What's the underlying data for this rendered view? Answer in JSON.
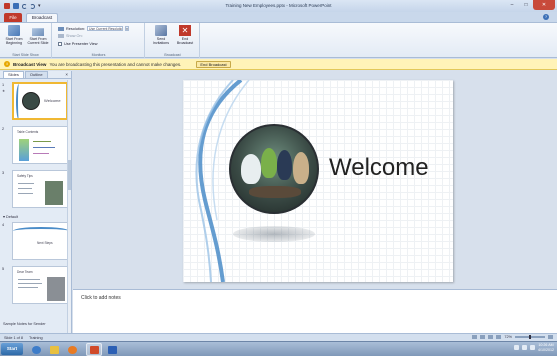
{
  "window": {
    "title": "Training New Employees.pptx - Microsoft PowerPoint",
    "minimize": "–",
    "maximize": "□",
    "close": "✕"
  },
  "qat": {
    "more": "▾"
  },
  "tabs": {
    "file": "File",
    "broadcast": "Broadcast",
    "help": "?"
  },
  "ribbon": {
    "start_broadcast": {
      "label": "Start From Beginning"
    },
    "start_current": {
      "label": "Start From Current Slide"
    },
    "start_group_label": "Start Slide Show",
    "monitor": {
      "resolution_label": "Resolution:",
      "resolution_value": "Use Current Resolution",
      "show_on_label": "Show On:",
      "presenter_view_label": "Use Presenter View",
      "group_label": "Monitors"
    },
    "send_invitations": {
      "label": "Send Invitations"
    },
    "end_broadcast": {
      "label": "End Broadcast",
      "icon_glyph": "✕"
    },
    "broadcast_group_label": "Broadcast"
  },
  "infobar": {
    "title": "Broadcast View",
    "message": "You are broadcasting this presentation and cannot make changes.",
    "button": "End Broadcast"
  },
  "left_panel": {
    "tab_slides": "Slides",
    "tab_outline": "Outline",
    "close_glyph": "×",
    "slides": [
      {
        "num": "1",
        "title": "Welcome"
      },
      {
        "num": "2",
        "title": "Table Contents"
      },
      {
        "num": "3",
        "title": "Safety Tips"
      },
      {
        "num": "4",
        "title": "Next Steps"
      },
      {
        "num": "5",
        "title": "Dear Team"
      }
    ],
    "section_label": "Default",
    "footer_label": "Sample Notes for Sender"
  },
  "slide": {
    "title": "Welcome"
  },
  "notes": {
    "placeholder": "Click to add notes"
  },
  "status": {
    "slide_info": "Slide 1 of 8",
    "theme": "Training",
    "zoom": "72%"
  },
  "taskbar": {
    "start": "Start",
    "apps": [
      {
        "icon": "ie-icon",
        "color": "#3d7cc9"
      },
      {
        "icon": "folder-icon",
        "color": "#e8c040"
      },
      {
        "icon": "media-player-icon",
        "color": "#e87b24"
      },
      {
        "icon": "powerpoint-icon",
        "color": "#d04a2a"
      },
      {
        "icon": "word-icon",
        "color": "#2b5fb4"
      }
    ],
    "clock_time": "10:26 AM",
    "clock_date": "4/10/2012"
  },
  "colors": {
    "accent": "#c0392b",
    "infobar": "#fff3b8",
    "ribbon_border": "#a9bcd6",
    "slide_swoosh": "#4a8cc8"
  }
}
